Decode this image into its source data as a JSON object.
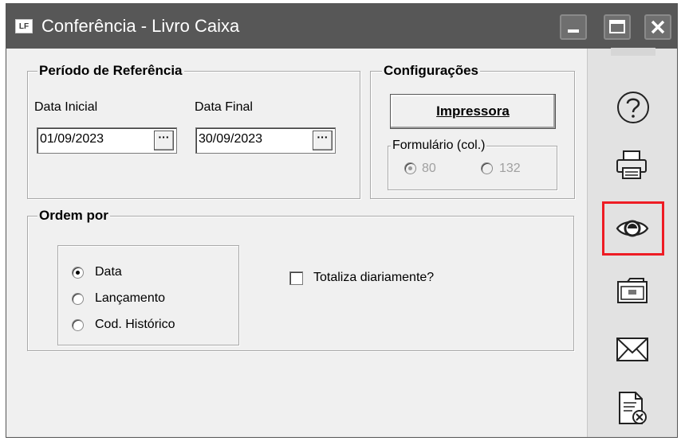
{
  "window": {
    "app_icon_text": "LF",
    "title": "Conferência - Livro Caixa"
  },
  "periodo": {
    "legend": "Período de Referência",
    "data_inicial_label": "Data Inicial",
    "data_inicial_value": "01/09/2023",
    "data_final_label": "Data Final",
    "data_final_value": "30/09/2023",
    "picker_label": "···"
  },
  "configuracoes": {
    "legend": "Configurações",
    "impressora_label": "Impressora",
    "formulario": {
      "legend": "Formulário (col.)",
      "options": [
        {
          "label": "80",
          "checked": true
        },
        {
          "label": "132",
          "checked": false
        }
      ]
    }
  },
  "ordem": {
    "legend": "Ordem por",
    "options": [
      {
        "label": "Data",
        "checked": true
      },
      {
        "label": "Lançamento",
        "checked": false
      },
      {
        "label": "Cod. Histórico",
        "checked": false
      }
    ],
    "totaliza_label": "Totaliza diariamente?",
    "totaliza_checked": false
  },
  "toolbar": {
    "icons": [
      "help-icon",
      "printer-icon",
      "eye-icon",
      "folder-icon",
      "mail-icon",
      "document-cancel-icon"
    ],
    "highlight_color": "#ee1c24"
  }
}
